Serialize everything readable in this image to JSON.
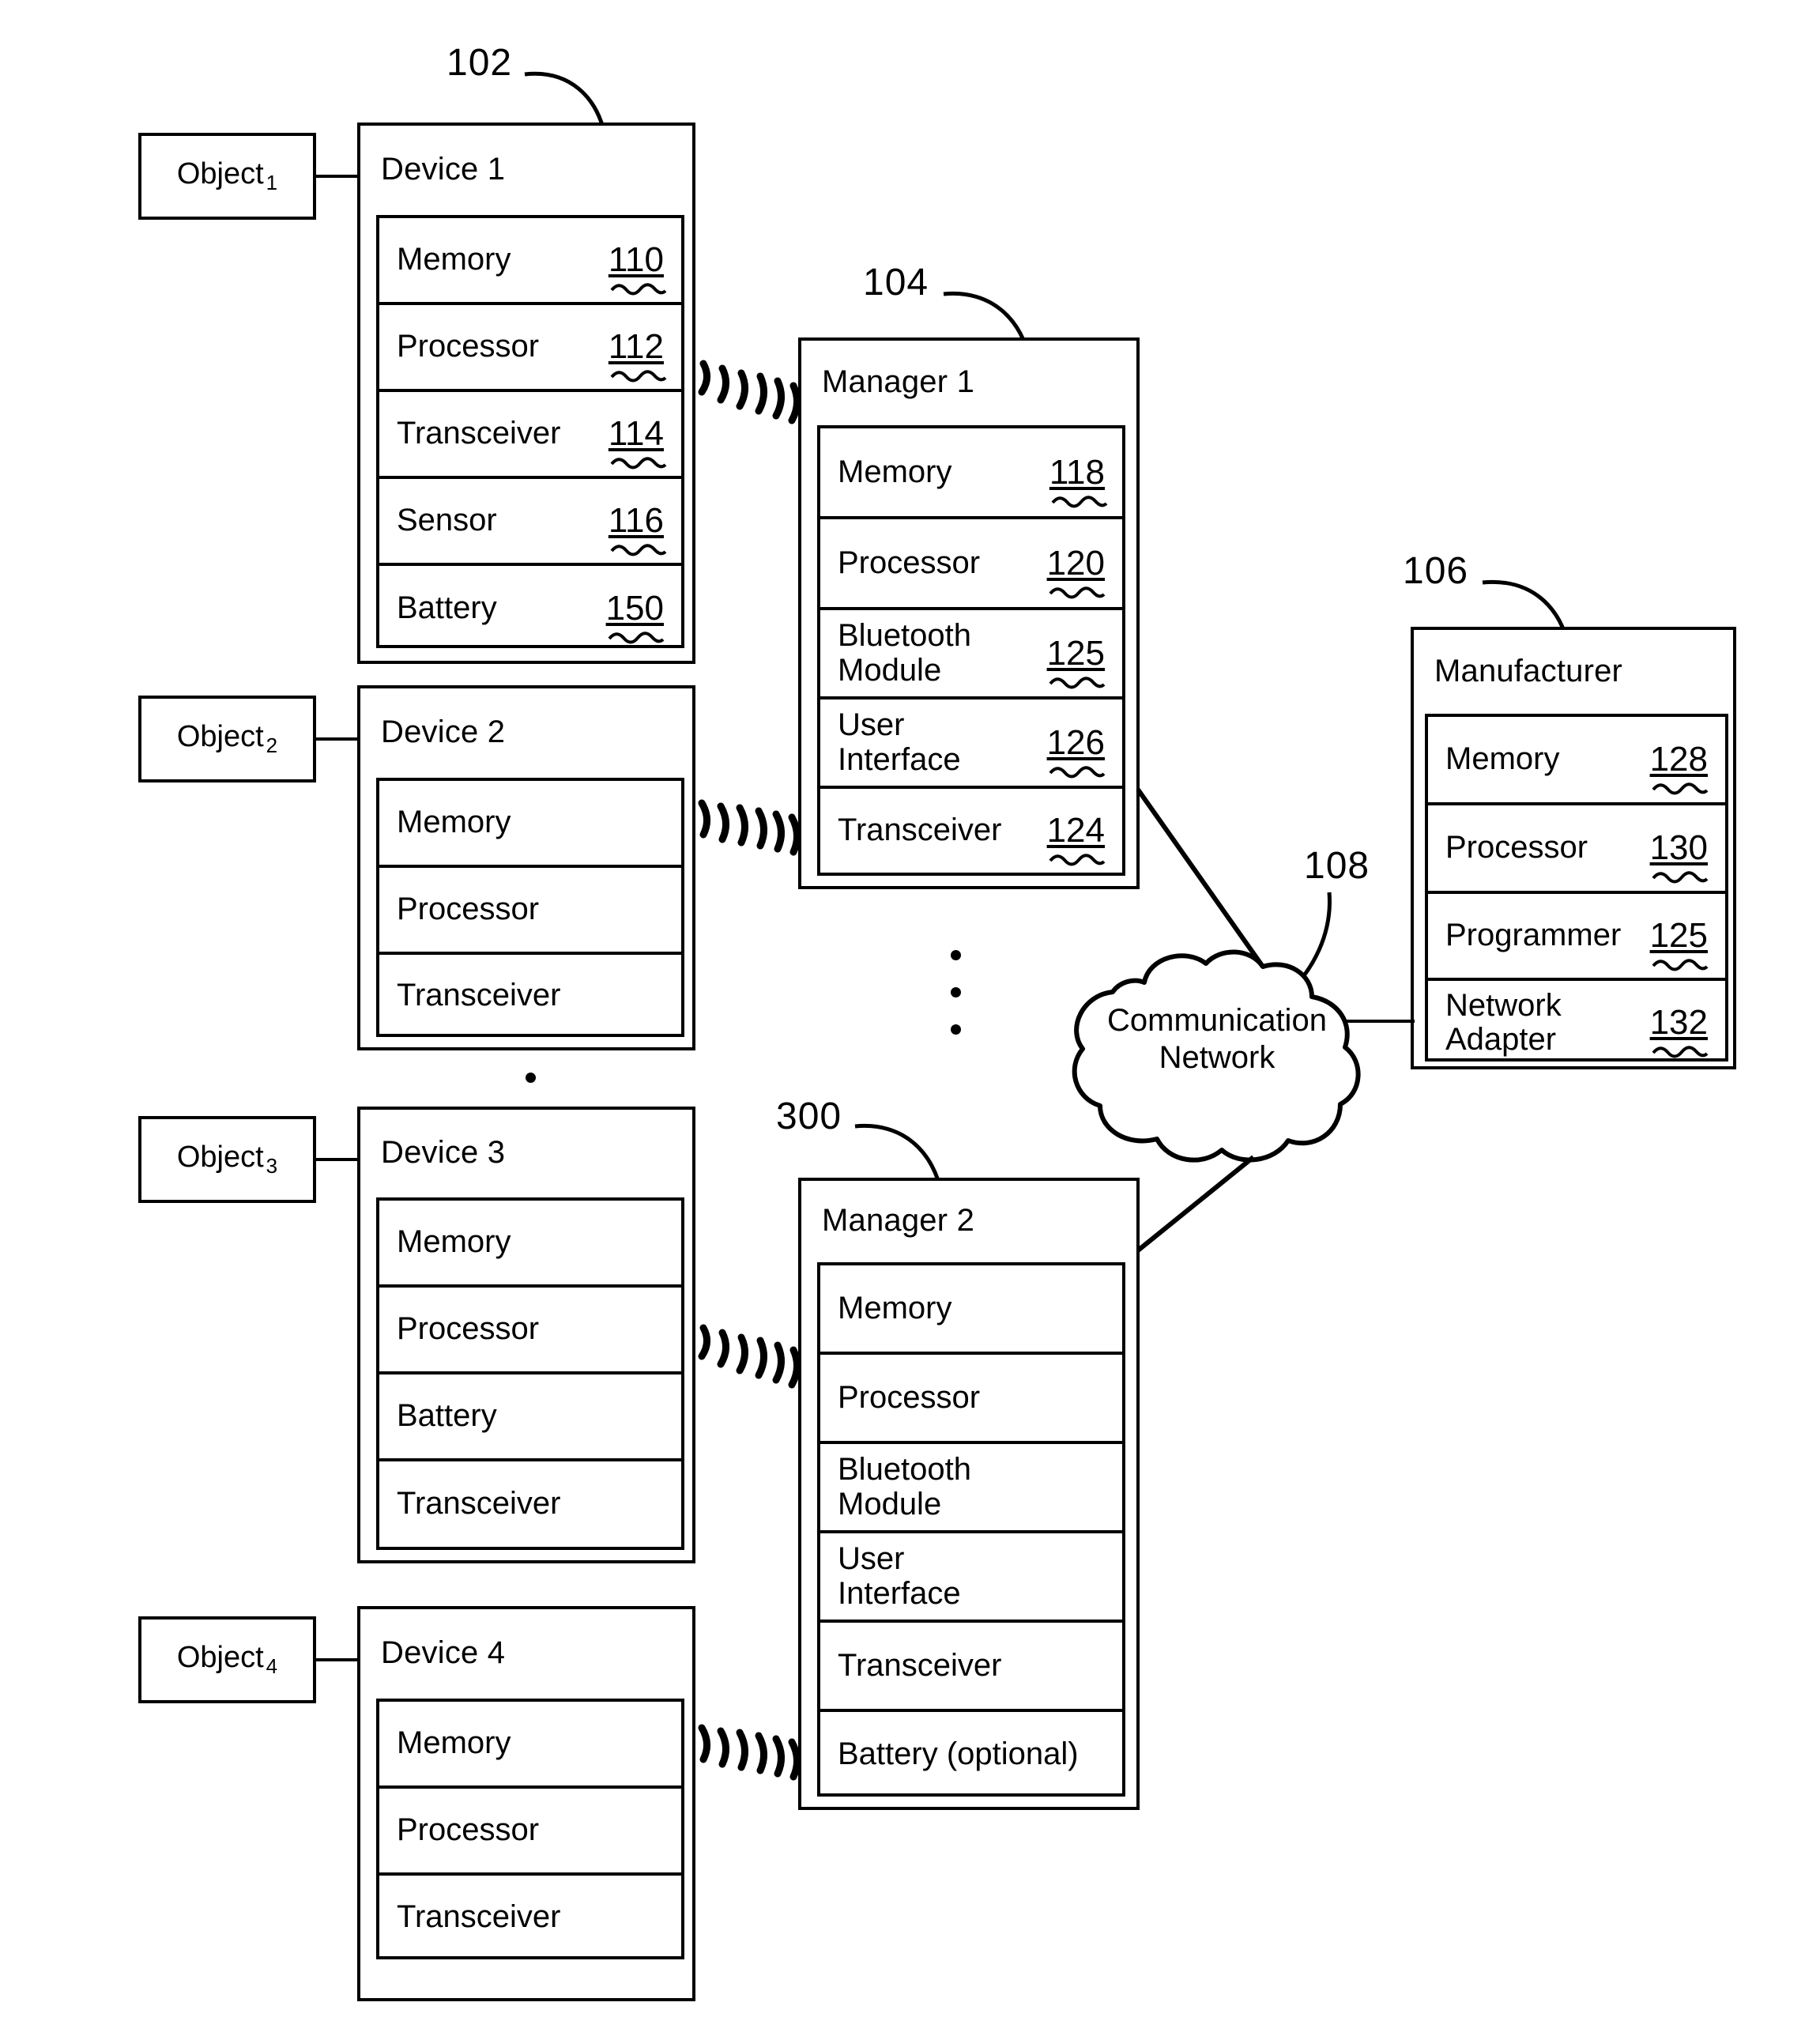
{
  "figure": {
    "refs": {
      "devices_group": "102",
      "manager1": "104",
      "manufacturer": "106",
      "network": "108",
      "manager2": "300"
    }
  },
  "objects": [
    {
      "name": "Object",
      "sub": "1"
    },
    {
      "name": "Object",
      "sub": "2"
    },
    {
      "name": "Object",
      "sub": "3"
    },
    {
      "name": "Object",
      "sub": "4"
    }
  ],
  "devices": [
    {
      "title": "Device 1",
      "rows": [
        {
          "label": "Memory",
          "num": "110"
        },
        {
          "label": "Processor",
          "num": "112"
        },
        {
          "label": "Transceiver",
          "num": "114"
        },
        {
          "label": "Sensor",
          "num": "116"
        },
        {
          "label": "Battery",
          "num": "150"
        }
      ]
    },
    {
      "title": "Device 2",
      "rows": [
        {
          "label": "Memory",
          "num": ""
        },
        {
          "label": "Processor",
          "num": ""
        },
        {
          "label": "Transceiver",
          "num": ""
        }
      ]
    },
    {
      "title": "Device 3",
      "rows": [
        {
          "label": "Memory",
          "num": ""
        },
        {
          "label": "Processor",
          "num": ""
        },
        {
          "label": "Battery",
          "num": ""
        },
        {
          "label": "Transceiver",
          "num": ""
        }
      ]
    },
    {
      "title": "Device 4",
      "rows": [
        {
          "label": "Memory",
          "num": ""
        },
        {
          "label": "Processor",
          "num": ""
        },
        {
          "label": "Transceiver",
          "num": ""
        }
      ]
    }
  ],
  "manager1": {
    "title": "Manager 1",
    "rows": [
      {
        "label": "Memory",
        "num": "118"
      },
      {
        "label": "Processor",
        "num": "120"
      },
      {
        "label": "Bluetooth\nModule",
        "num": "125"
      },
      {
        "label": "User\nInterface",
        "num": "126"
      },
      {
        "label": "Transceiver",
        "num": "124"
      }
    ]
  },
  "manager2": {
    "title": "Manager 2",
    "rows": [
      {
        "label": "Memory",
        "num": ""
      },
      {
        "label": "Processor",
        "num": ""
      },
      {
        "label": "Bluetooth\nModule",
        "num": ""
      },
      {
        "label": "User\nInterface",
        "num": ""
      },
      {
        "label": "Transceiver",
        "num": ""
      },
      {
        "label": "Battery (optional)",
        "num": ""
      }
    ]
  },
  "manufacturer": {
    "title": "Manufacturer",
    "rows": [
      {
        "label": "Memory",
        "num": "128"
      },
      {
        "label": "Processor",
        "num": "130"
      },
      {
        "label": "Programmer",
        "num": "125"
      },
      {
        "label": "Network\nAdapter",
        "num": "132"
      }
    ]
  },
  "network": {
    "line1": "Communication",
    "line2": "Network"
  }
}
